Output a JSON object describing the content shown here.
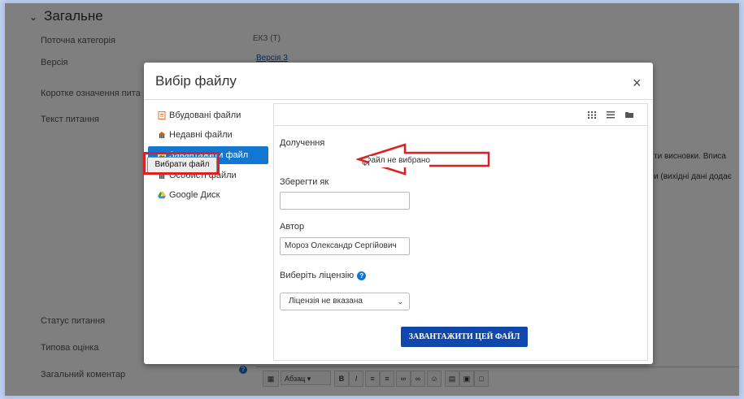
{
  "background": {
    "section_title": "Загальне",
    "rows": [
      {
        "label": "Поточна категорія",
        "value": "ЕКЗ (T)"
      },
      {
        "label": "Версія",
        "value": "Версія 3"
      },
      {
        "label": "Коротке означення пита"
      },
      {
        "label": "Текст питання"
      },
      {
        "label": "Статус питання"
      },
      {
        "label": "Типова оцінка"
      },
      {
        "label": "Загальний коментар"
      }
    ],
    "right_text_1": "ти висновки. Вписа",
    "right_text_2": "и (вихідні дані додає",
    "editor_format": "Абзац"
  },
  "modal": {
    "title": "Вибір файлу",
    "close": "×",
    "repositories": [
      {
        "label": "Вбудовані файли",
        "icon": "embedded-files-icon"
      },
      {
        "label": "Недавні файли",
        "icon": "recent-files-icon"
      },
      {
        "label": "Завантажити файл",
        "icon": "upload-file-icon",
        "active": true
      },
      {
        "label": "Особисті файли",
        "icon": "private-files-icon"
      },
      {
        "label": "Google Диск",
        "icon": "google-drive-icon"
      }
    ],
    "form": {
      "attachment_label": "Долучення",
      "choose_file_button": "Вибрати файл",
      "file_status": "Файл не вибрано",
      "save_as_label": "Зберегти як",
      "save_as_value": "",
      "author_label": "Автор",
      "author_value": "Мороз Олександр Сергійович",
      "license_label": "Виберіть ліцензію",
      "license_value": "Ліцензія не вказана",
      "upload_button": "ЗАВАНТАЖИТИ ЦЕЙ ФАЙЛ"
    }
  },
  "colors": {
    "accent": "#1177d1",
    "upload_button": "#0f47ad",
    "annotation_red": "#e02020"
  }
}
